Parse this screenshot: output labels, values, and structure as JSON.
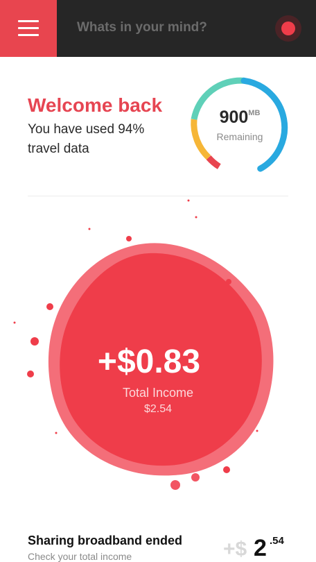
{
  "header": {
    "search_text": "Whats in your mind?",
    "icons": {
      "menu": "hamburger-menu-icon",
      "record": "record-icon"
    },
    "colors": {
      "bar_bg": "#262626",
      "menu_bg": "#e8454f",
      "record": "#ef3d4a"
    }
  },
  "welcome": {
    "title": "Welcome back",
    "message": "You have used 94% travel data"
  },
  "data_gauge": {
    "value": "900",
    "unit": "MB",
    "label": "Remaining",
    "arc_colors": [
      "#e8454f",
      "#f6b637",
      "#5fd0b8",
      "#29a9e0"
    ]
  },
  "income": {
    "amount": "+$0.83",
    "label": "Total Income",
    "total": "$2.54",
    "color": "#ef3d4a"
  },
  "notification": {
    "title": "Sharing broadband ended",
    "subtitle": "Check your total income",
    "amount_sign": "+$",
    "amount_whole": "2",
    "amount_cents": ".54"
  }
}
